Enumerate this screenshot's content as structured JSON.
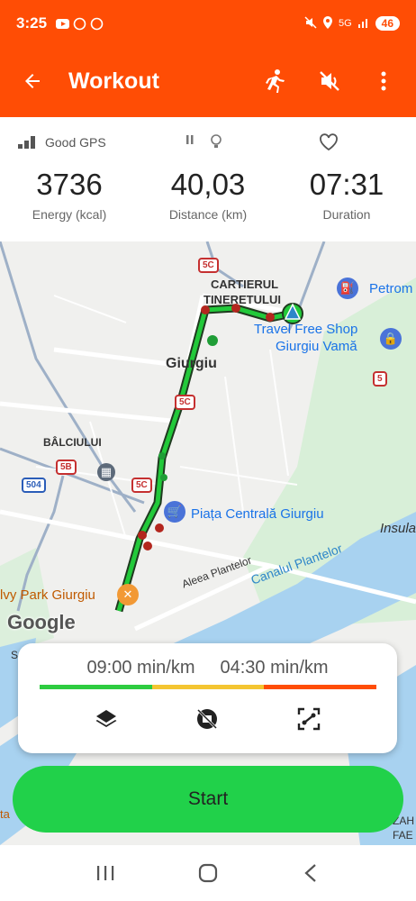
{
  "status_bar": {
    "time": "3:25",
    "network": "5G",
    "battery": "46"
  },
  "toolbar": {
    "title": "Workout",
    "icons": [
      "back-arrow-icon",
      "runner-icon",
      "mute-icon",
      "more-vert-icon"
    ]
  },
  "stats": {
    "gps_label": "Good GPS",
    "energy": {
      "value": "3736",
      "label": "Energy (kcal)"
    },
    "distance": {
      "value": "40,03",
      "label": "Distance (km)"
    },
    "duration": {
      "value": "07:31",
      "label": "Duration"
    }
  },
  "map": {
    "labels": {
      "cartierul": "CARTIERUL",
      "tineretului": "TINERETULUI",
      "giurgiu": "Giurgiu",
      "balciului": "BÂLCIULUI",
      "travel_free_1": "Travel Free Shop",
      "travel_free_2": "Giurgiu Vamă",
      "petrom": "Petrom",
      "piata": "Piața Centrală Giurgiu",
      "insula": "Insula",
      "aleea": "Aleea Plantelor",
      "canalul": "Canalul Plantelor",
      "ivy_park": "lvy Park Giurgiu",
      "google": "Google",
      "s_edge": "S",
      "zah": "ZAH",
      "fae": "FAE",
      "start_edge": "ta"
    },
    "shields": [
      "5C",
      "5C",
      "5B",
      "504",
      "5C",
      "5"
    ],
    "colors": {
      "route": "#22c93a",
      "route_outline": "#1f3a1f",
      "marker": "#b3261e"
    }
  },
  "pace": {
    "slow": "09:00 min/km",
    "fast": "04:30 min/km",
    "colors": [
      "#2ecc40",
      "#f4c531",
      "#ff4d05"
    ]
  },
  "card_icons": [
    "layers-icon",
    "no-hide-map-icon",
    "fit-route-icon"
  ],
  "start_label": "Start",
  "nav": [
    "recents-icon",
    "home-icon",
    "back-icon"
  ]
}
